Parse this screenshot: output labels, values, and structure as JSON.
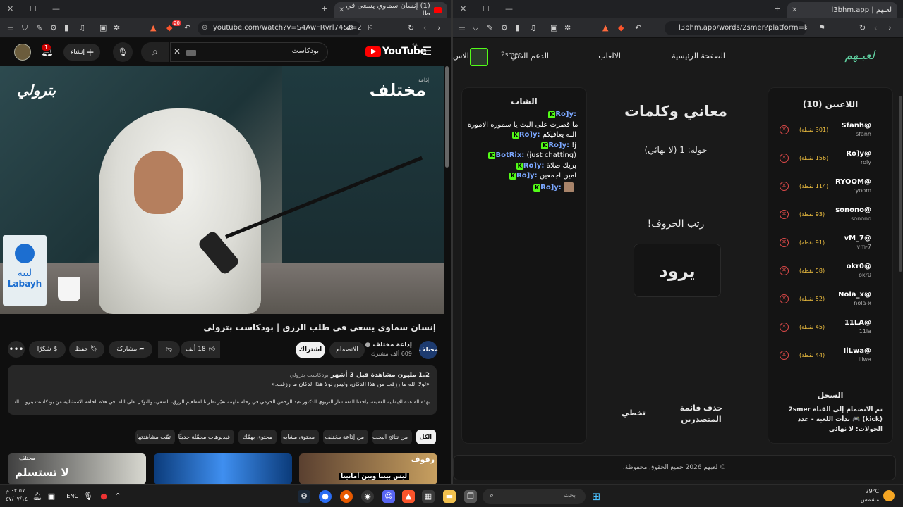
{
  "left_browser": {
    "tab_title": "(1) إنسان سماوي يسعى في طلـ",
    "url": "youtube.com/watch?v=S4AwFRvrl74&t=20s",
    "notification_count": "1",
    "shield_count": "20"
  },
  "youtube": {
    "logo": "YouTube",
    "region": "SA",
    "search_query": "بودكاست",
    "create_label": "إنشاء",
    "notifications": "1",
    "video_brand_right": "مختلف",
    "video_brand_right_small": "إذاعة",
    "video_brand_left": "بترولي",
    "labayh": "لبيه",
    "labayh_en": "Labayh",
    "video_title": "إنسان سماوي يسعى في طلب الرزق | بودكاست بترولي",
    "channel_name": "إذاعة مختلف",
    "subscribers": "609 ألف مشترك",
    "join_label": "الانضمام",
    "subscribe_label": "اشتراك",
    "likes": "18 ألف",
    "share_label": "مشاركة",
    "save_label": "حفظ",
    "thanks_label": "شكرًا",
    "desc_stats": "1.2 مليون مشاهدة قبل 3 أشهر",
    "desc_tag": "بودكاست بترولي",
    "desc_line1": "«لولا الله ما رزقت من هذا الدكان، وليس لولا هذا الدكان ما رزقت.»",
    "desc_line2": "بهذه القاعدة الإيمانية العميقة، يأخذنا المستشار التربوي الدكتور عبد الرحمن الحرمي في رحلة ملهمة تغيّر نظرتنا لمفاهيم الرزق، السعي، والتوكل على الله. في هذه الحلقة الاستثنائية من بودكاست بترو ...المزيد",
    "chips": [
      "الكل",
      "من نتائج البحث",
      "من إذاعة مختلف",
      "محتوى مشابه",
      "محتوى بهمّك",
      "فيديوهات محمّلة حديثًا",
      "تمّت مشاهدتها"
    ],
    "thumb1_text": "رفوف",
    "thumb1_sub": "ليس بيننا وبين أمانينا",
    "thumb3_text": "لا تستسلم",
    "thumb3_top": "مختلف"
  },
  "right_browser": {
    "tab_title": "لعبهم | l3bhm.app",
    "url": "l3bhm.app/words/2smer?platform=kick"
  },
  "game": {
    "logo": "لعبـهم",
    "nav": [
      "الصفحة الرئيسية",
      "الالعاب",
      "الدعم الفني",
      "الاس"
    ],
    "username": "2smer",
    "players_title": "اللاعبين (10)",
    "players": [
      {
        "name": "@Sfanh",
        "sub": "sfanh",
        "score": "(301 نقطة)"
      },
      {
        "name": "@Ro]y",
        "sub": "roly",
        "score": "(156 نقطة)"
      },
      {
        "name": "@RYOOM",
        "sub": "ryoom",
        "score": "(114 نقطة)"
      },
      {
        "name": "@sonono",
        "sub": "sonono",
        "score": "(93 نقطة)"
      },
      {
        "name": "@vM_7",
        "sub": "vm-7",
        "score": "(91 نقطة)"
      },
      {
        "name": "@okr0",
        "sub": "okr0",
        "score": "(58 نقطة)"
      },
      {
        "name": "@Nola_x",
        "sub": "nola-x",
        "score": "(52 نقطة)"
      },
      {
        "name": "@11LA",
        "sub": "11la",
        "score": "(45 نقطة)"
      },
      {
        "name": "@IlLwa",
        "sub": "illwa",
        "score": "(44 نقطة)"
      }
    ],
    "log_title": "السجل",
    "log_text": "تم الانضمام إلى القناة 2smer (kick) 🎮 بدأت اللعبة - عدد الجولات: لا نهائي",
    "game_title": "معاني وكلمات",
    "round": "جولة: 1 (لا نهائي)",
    "instruction": "رتب الحروف!",
    "scrambled": "يرود",
    "leaderboard_btn": "حذف قائمة المتصدرين",
    "skip_btn": "تخطي",
    "chat_title": "الشات",
    "chat": [
      {
        "user": "Ro]y:",
        "msg": ""
      },
      {
        "user": "",
        "msg": "ما قصرت على البث يا سموره الامورة"
      },
      {
        "user": "Ro]y:",
        "msg": "الله يعافيكم"
      },
      {
        "user": "Ro]y:",
        "msg": "!j"
      },
      {
        "user": "BotRix:",
        "msg": "(just chatting)"
      },
      {
        "user": "Ro]y:",
        "msg": "بريك صلاة"
      },
      {
        "user": "Ro]y:",
        "msg": "امين اجمعين"
      },
      {
        "user": "Ro]y:",
        "msg": ""
      }
    ],
    "footer": "© لعبهم 2026 جميع الحقوق محفوظة."
  },
  "taskbar": {
    "time": "٠٣:٥٧ م",
    "date": "٤٧/٠٧/١٤",
    "lang": "ENG",
    "search_placeholder": "بحث",
    "weather_temp": "29°C",
    "weather_desc": "مشمس"
  },
  "colors": {
    "youtube_red": "#ff0000",
    "kick_green": "#53fc18",
    "score_gold": "#f0c040"
  }
}
